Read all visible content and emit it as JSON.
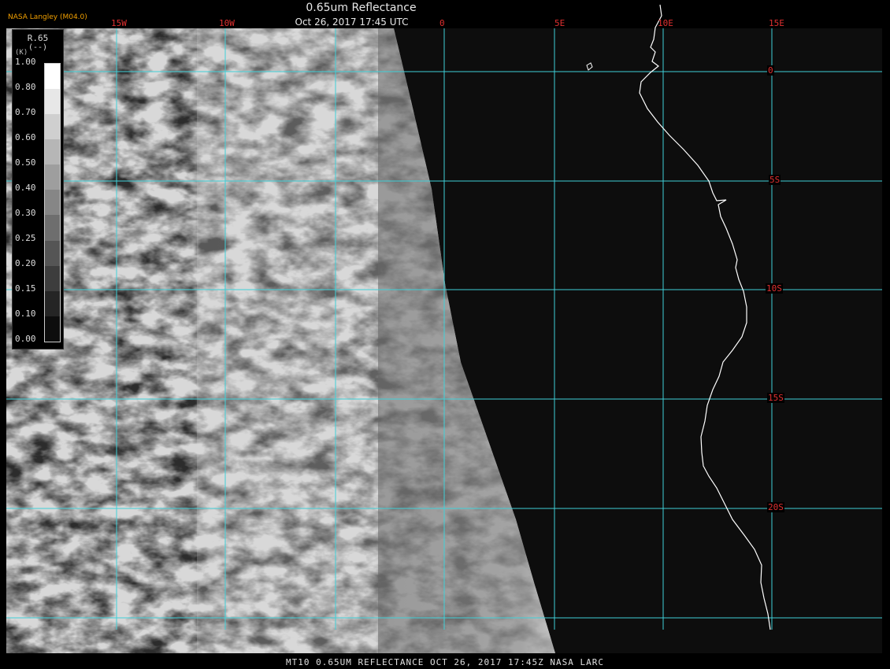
{
  "header": {
    "producer": "NASA Langley (M04.0)",
    "title": "0.65um Reflectance",
    "datetime": "Oct 26, 2017 17:45 UTC"
  },
  "lon_labels": [
    "15W",
    "10W",
    "0",
    "5E",
    "10E",
    "15E"
  ],
  "lat_labels": [
    "0",
    "5S",
    "10S",
    "15S",
    "20S"
  ],
  "legend": {
    "parameter": "R.65",
    "unit": "(--)",
    "unit_prefix": "(K)",
    "ticks": [
      "1.00",
      "0.80",
      "0.70",
      "0.60",
      "0.50",
      "0.40",
      "0.30",
      "0.25",
      "0.20",
      "0.15",
      "0.10",
      "0.00"
    ]
  },
  "colors": {
    "grid": "#3fd0d8",
    "coast": "#ffffff",
    "label": "#e03030",
    "producer": "#f2a000"
  },
  "footer": "MT10  0.65UM REFLECTANCE   OCT 26, 2017 17:45Z   NASA LARC"
}
